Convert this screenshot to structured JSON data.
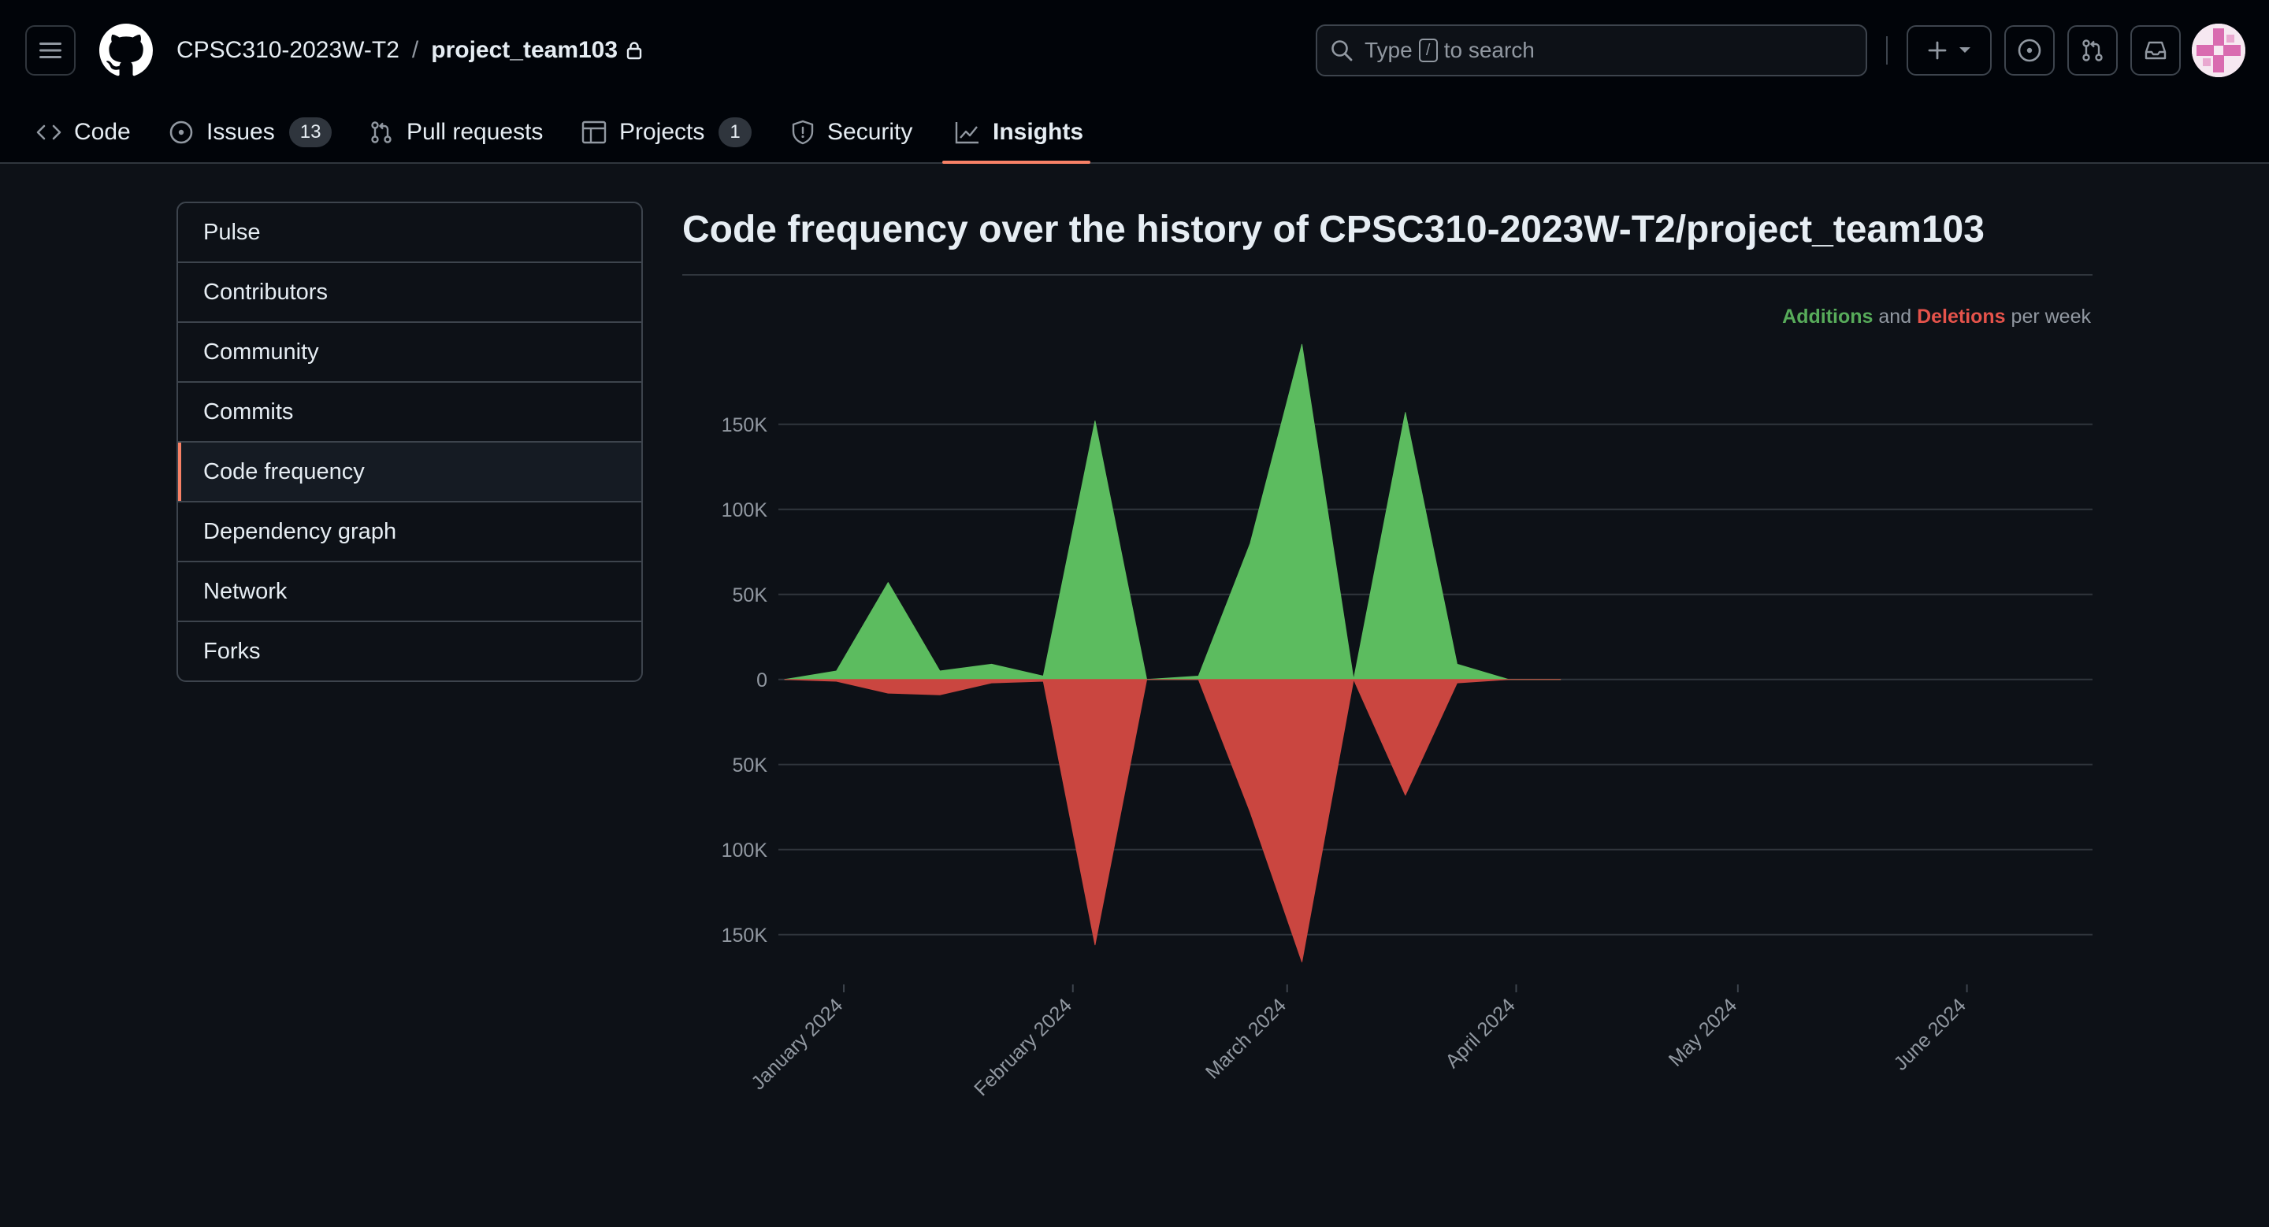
{
  "header": {
    "owner": "CPSC310-2023W-T2",
    "separator": "/",
    "repo": "project_team103",
    "search_prefix": "Type",
    "search_key": "/",
    "search_suffix": "to search"
  },
  "nav": {
    "tabs": [
      {
        "label": "Code"
      },
      {
        "label": "Issues",
        "count": "13"
      },
      {
        "label": "Pull requests"
      },
      {
        "label": "Projects",
        "count": "1"
      },
      {
        "label": "Security"
      },
      {
        "label": "Insights"
      }
    ],
    "active_tab": "Insights"
  },
  "sidebar": {
    "items": [
      {
        "label": "Pulse"
      },
      {
        "label": "Contributors"
      },
      {
        "label": "Community"
      },
      {
        "label": "Commits"
      },
      {
        "label": "Code frequency"
      },
      {
        "label": "Dependency graph"
      },
      {
        "label": "Network"
      },
      {
        "label": "Forks"
      }
    ],
    "selected": "Code frequency"
  },
  "page": {
    "title_prefix": "Code frequency over the history of",
    "title_repo": "CPSC310-2023W-T2/project_team103"
  },
  "legend": {
    "additions": "Additions",
    "and": "and",
    "deletions": "Deletions",
    "suffix": "per week"
  },
  "colors": {
    "additions": "#5cbc5f",
    "deletions": "#ca4640",
    "accent": "#f78166",
    "grid": "#30363d"
  },
  "chart_data": {
    "type": "area",
    "x": [
      "2023-12-24",
      "2023-12-31",
      "2024-01-07",
      "2024-01-14",
      "2024-01-21",
      "2024-01-28",
      "2024-02-04",
      "2024-02-11",
      "2024-02-18",
      "2024-02-25",
      "2024-03-03",
      "2024-03-10",
      "2024-03-17",
      "2024-03-24",
      "2024-03-31",
      "2024-04-07"
    ],
    "series": [
      {
        "name": "Additions",
        "values": [
          0,
          5000,
          57000,
          5000,
          9000,
          2000,
          152000,
          0,
          2000,
          80000,
          197000,
          0,
          157000,
          9000,
          0,
          0
        ]
      },
      {
        "name": "Deletions",
        "values": [
          0,
          -1000,
          -8000,
          -9000,
          -2000,
          -1000,
          -156000,
          0,
          0,
          -78000,
          -166000,
          0,
          -68000,
          -2000,
          0,
          0
        ]
      }
    ],
    "yticks": [
      "150K",
      "100K",
      "50K",
      "0",
      "50K",
      "100K",
      "150K"
    ],
    "ytick_values": [
      150000,
      100000,
      50000,
      0,
      -50000,
      -100000,
      -150000
    ],
    "ylim": [
      -170000,
      205000
    ],
    "xticks": [
      "January 2024",
      "February 2024",
      "March 2024",
      "April 2024",
      "May 2024",
      "June 2024"
    ],
    "xtick_dates": [
      "2024-01-01",
      "2024-02-01",
      "2024-03-01",
      "2024-04-01",
      "2024-05-01",
      "2024-06-01"
    ],
    "xlim": [
      "2023-12-24",
      "2024-06-18"
    ],
    "grid": true
  }
}
